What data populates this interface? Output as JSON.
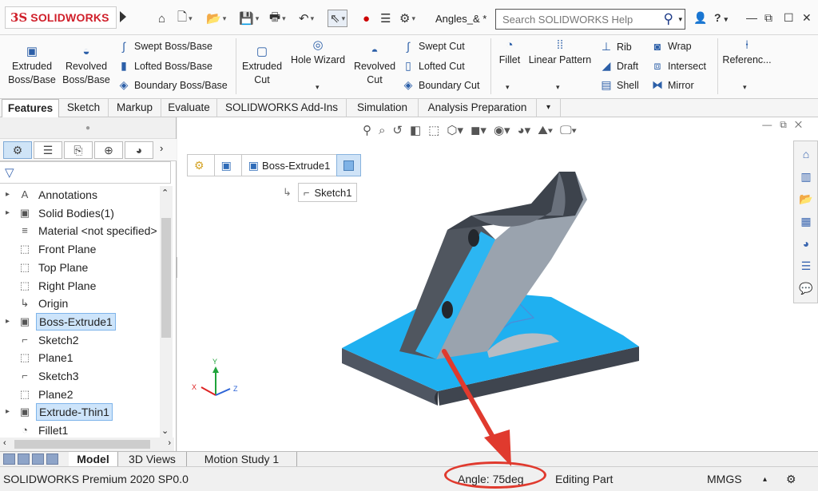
{
  "app": {
    "logo_ds": "3S",
    "logo_text": "SOLIDWORKS",
    "doc_title": "Angles_& *",
    "help_placeholder": "Search SOLIDWORKS Help",
    "help_extra": "?"
  },
  "toolbar": {
    "extruded_boss": [
      "Extruded",
      "Boss/Base"
    ],
    "revolved_boss": [
      "Revolved",
      "Boss/Base"
    ],
    "swept_boss": "Swept Boss/Base",
    "lofted_boss": "Lofted Boss/Base",
    "boundary_boss": "Boundary Boss/Base",
    "extruded_cut": [
      "Extruded",
      "Cut"
    ],
    "hole_wizard": "Hole Wizard",
    "revolved_cut": [
      "Revolved",
      "Cut"
    ],
    "swept_cut": "Swept Cut",
    "lofted_cut": "Lofted Cut",
    "boundary_cut": "Boundary Cut",
    "fillet": "Fillet",
    "linear_pattern": "Linear Pattern",
    "rib": "Rib",
    "draft": "Draft",
    "shell": "Shell",
    "wrap": "Wrap",
    "intersect": "Intersect",
    "mirror": "Mirror",
    "reference": "Referenc..."
  },
  "tabs": [
    "Features",
    "Sketch",
    "Markup",
    "Evaluate",
    "SOLIDWORKS Add-Ins",
    "Simulation",
    "Analysis Preparation"
  ],
  "tree": [
    {
      "label": "Annotations",
      "icon": "A",
      "expand": true
    },
    {
      "label": "Solid Bodies(1)",
      "icon": "▣",
      "expand": true
    },
    {
      "label": "Material <not specified>",
      "icon": "≡",
      "expand": false
    },
    {
      "label": "Front Plane",
      "icon": "⬚",
      "expand": false
    },
    {
      "label": "Top Plane",
      "icon": "⬚",
      "expand": false
    },
    {
      "label": "Right Plane",
      "icon": "⬚",
      "expand": false
    },
    {
      "label": "Origin",
      "icon": "↳",
      "expand": false
    },
    {
      "label": "Boss-Extrude1",
      "icon": "▣",
      "expand": true,
      "selected": true
    },
    {
      "label": "Sketch2",
      "icon": "⌐",
      "expand": false
    },
    {
      "label": "Plane1",
      "icon": "⬚",
      "expand": false
    },
    {
      "label": "Sketch3",
      "icon": "⌐",
      "expand": false
    },
    {
      "label": "Plane2",
      "icon": "⬚",
      "expand": false
    },
    {
      "label": "Extrude-Thin1",
      "icon": "▣",
      "expand": true,
      "selected": true
    },
    {
      "label": "Fillet1",
      "icon": "◔",
      "expand": false
    }
  ],
  "breadcrumb": {
    "item": "Boss-Extrude1",
    "sub": "Sketch1"
  },
  "triad": {
    "x": "X",
    "y": "Y",
    "z": "Z"
  },
  "bottom_tabs": [
    "Model",
    "3D Views",
    "Motion Study 1"
  ],
  "status": {
    "product": "SOLIDWORKS Premium 2020 SP0.0",
    "angle": "Angle: 75deg",
    "mode": "Editing Part",
    "units": "MMGS",
    "units_arrow": "▴"
  },
  "colors": {
    "brand_red": "#d0202b",
    "selection_cyan": "#1fb0f0",
    "annotation_red": "#e03a2e"
  }
}
